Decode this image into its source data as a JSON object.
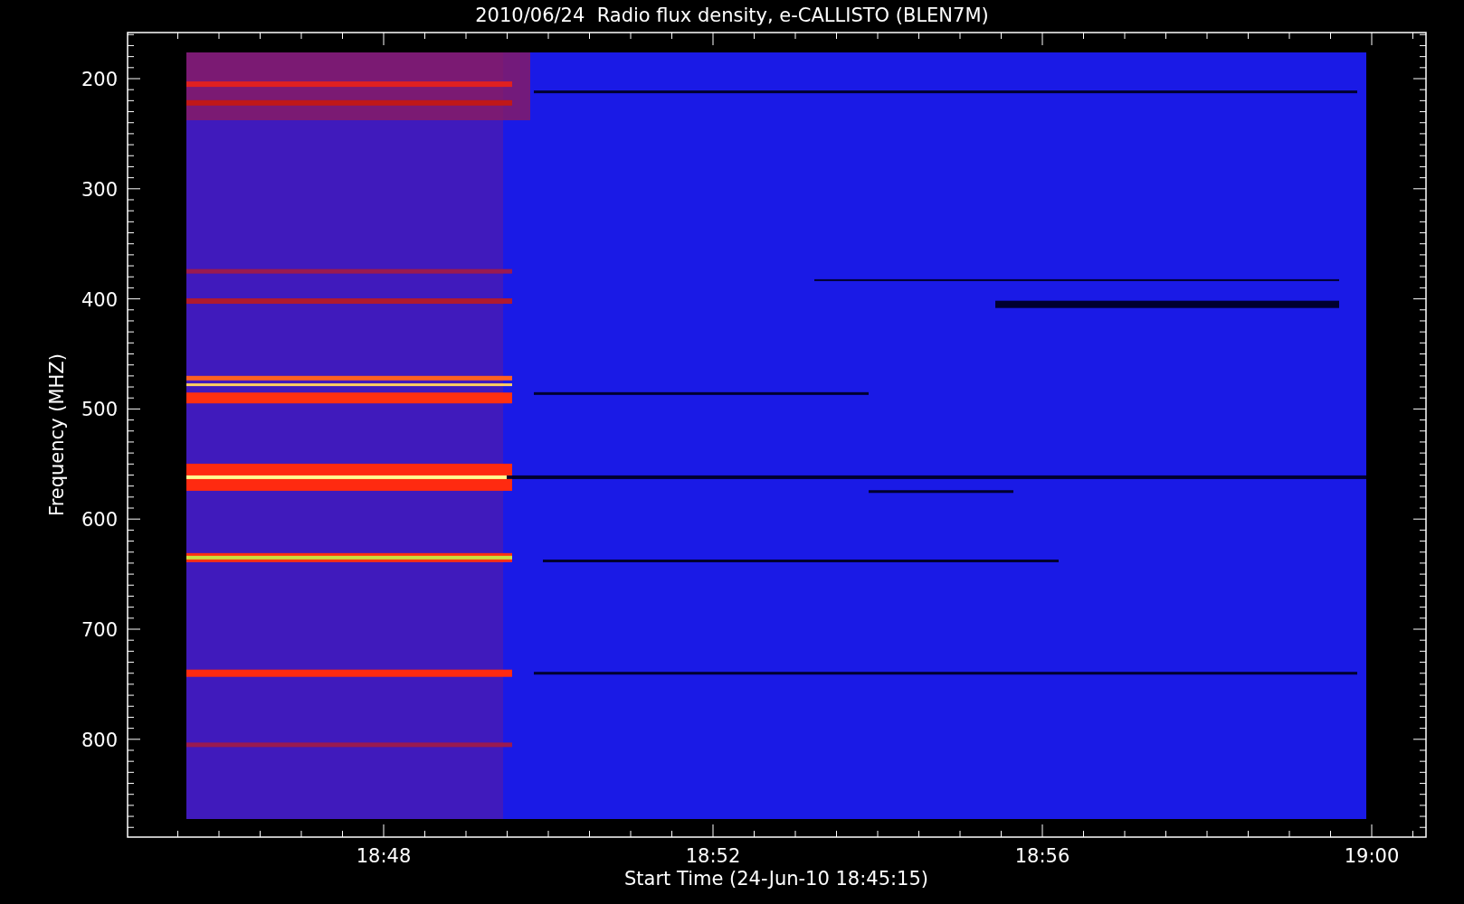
{
  "title": "2010/06/24  Radio flux density, e-CALLISTO (BLEN7M)",
  "y_axis": {
    "label": "Frequency (MHZ)",
    "ticks": [
      "200",
      "300",
      "400",
      "500",
      "600",
      "700",
      "800"
    ]
  },
  "x_axis": {
    "label": "Start Time (24-Jun-10 18:45:15)",
    "ticks": [
      "18:48",
      "18:52",
      "18:56",
      "19:00"
    ]
  }
}
